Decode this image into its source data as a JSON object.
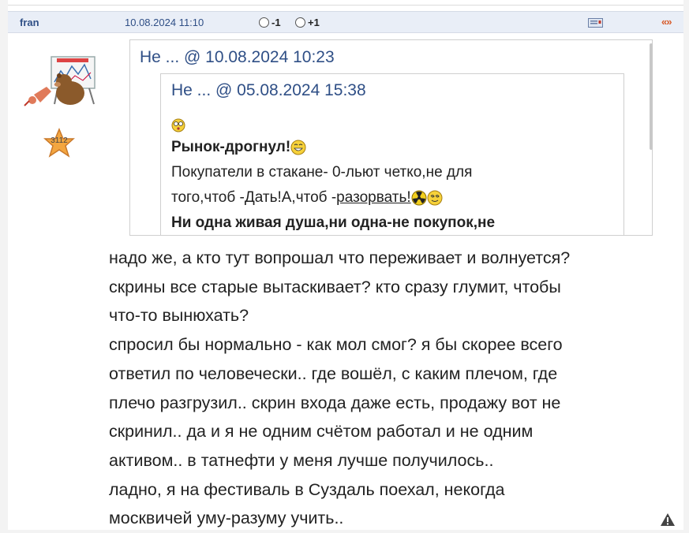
{
  "post": {
    "author": "fran",
    "date": "10.08.2024 11:10",
    "vote_minus": "-1",
    "vote_plus": "+1",
    "nav_arrows": "«»",
    "rating": "3112"
  },
  "quote_outer": {
    "header": "Не ... @ 10.08.2024 10:23"
  },
  "quote_inner": {
    "header": "Не ... @ 05.08.2024 15:38",
    "line1": "Рынок-дрогнул!",
    "line2": "Покупатели в стакане- 0-льют четко,не для",
    "line3_a": "того,чтоб -Дать!А,чтоб -",
    "line3_b": "разорвать!",
    "line4": "Ни одна живая душа,ни одна-не покупок,не"
  },
  "body": {
    "lines": [
      "надо же, а кто тут вопрошал что переживает и волнуется?",
      "скрины все старые вытаскивает? кто сразу глумит, чтобы",
      "что-то вынюхать?",
      "спросил бы нормально - как мол смог? я бы скорее всего",
      "ответил по человечески.. где вошёл, с каким плечом, где",
      "плечо разгрузил.. скрин входа даже есть, продажу вот не",
      "скринил.. да и я не одним счётом работал и не одним",
      "активом.. в татнефти у меня лучше получилось..",
      "ладно, я на фестиваль в Суздаль поехал, некогда",
      "москвичей уму-разуму учить.."
    ]
  },
  "colors": {
    "header_bg": "#e9eef7",
    "link": "#2f4f86",
    "accent": "#d85b2a"
  },
  "icons": [
    "message-icon",
    "warning-icon",
    "rating-star-icon",
    "smiley-icon",
    "radiation-icon"
  ]
}
